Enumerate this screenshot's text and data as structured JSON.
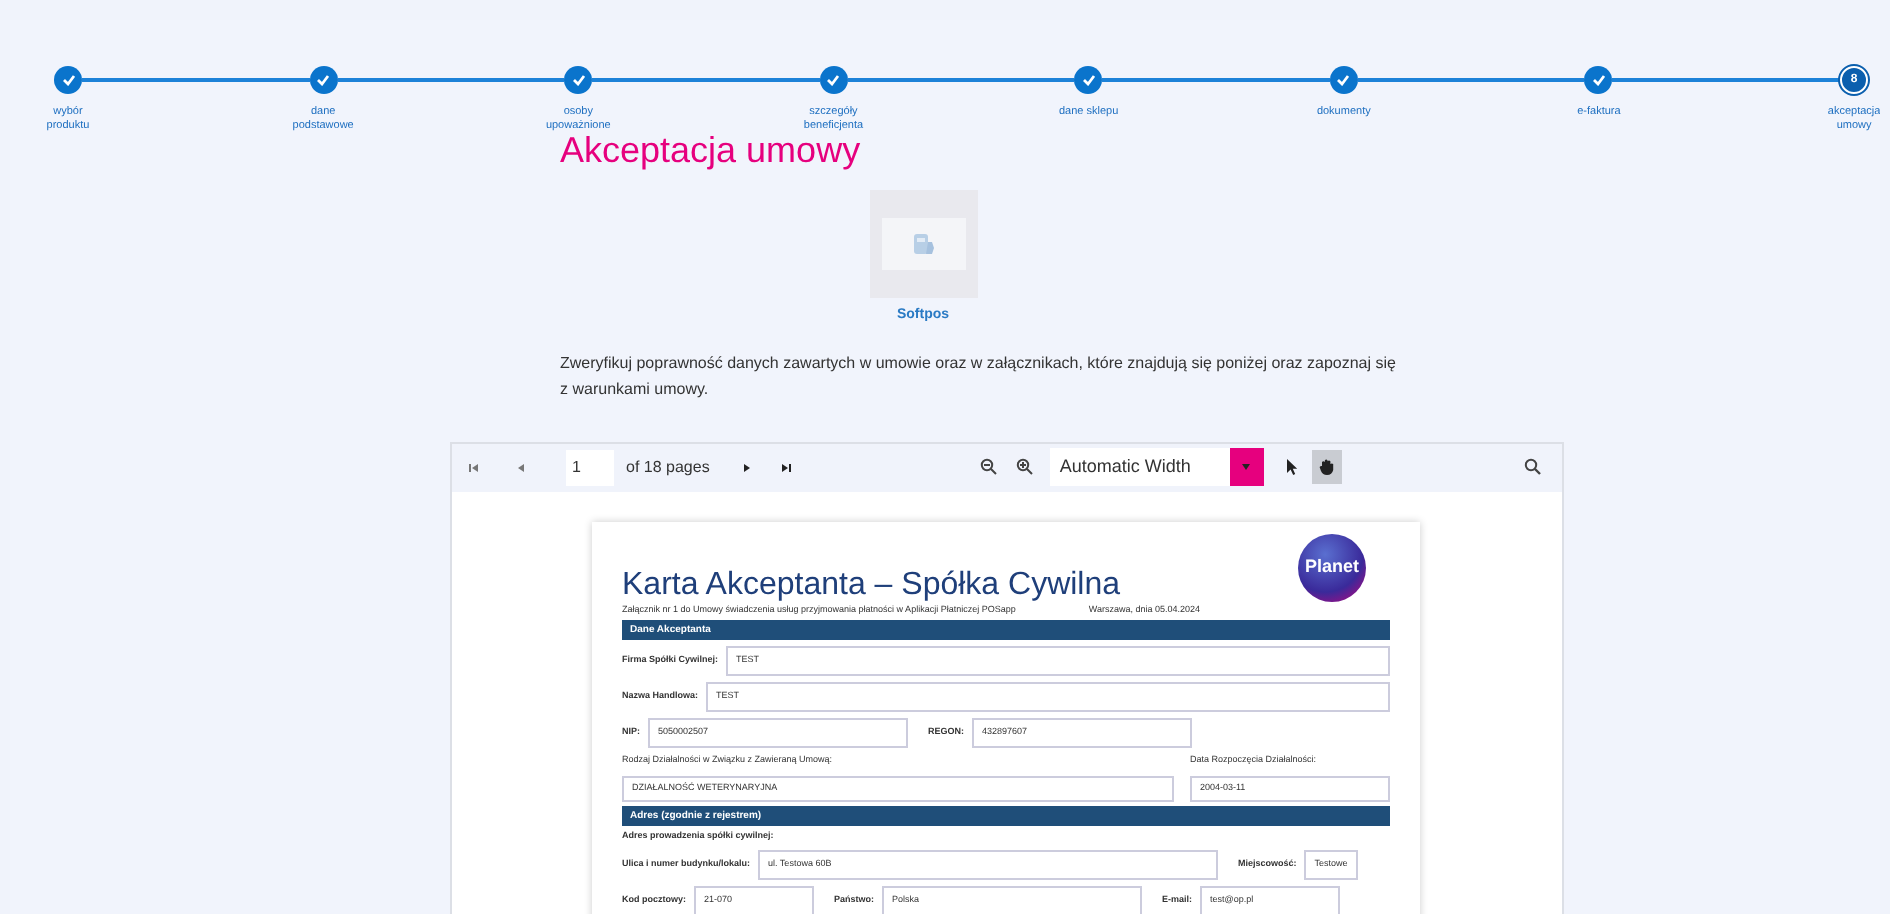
{
  "steps": [
    {
      "label": "wybór produktu",
      "completed": true,
      "current": false
    },
    {
      "label": "dane podstawowe",
      "completed": true,
      "current": false
    },
    {
      "label": "osoby upoważnione",
      "completed": true,
      "current": false
    },
    {
      "label": "szczegóły beneficjenta",
      "completed": true,
      "current": false
    },
    {
      "label": "dane sklepu",
      "completed": true,
      "current": false
    },
    {
      "label": "dokumenty",
      "completed": true,
      "current": false
    },
    {
      "label": "e-faktura",
      "completed": true,
      "current": false
    },
    {
      "label": "akceptacja umowy",
      "completed": false,
      "current": true,
      "number": "8"
    }
  ],
  "title": "Akceptacja umowy",
  "product": {
    "name": "Softpos"
  },
  "instruction": "Zweryfikuj poprawność danych zawartych w umowie oraz w załącznikach, które znajdują się poniżej oraz zapoznaj się z warunkami umowy.",
  "viewer": {
    "page": "1",
    "page_count": "of 18 pages",
    "zoom": "Automatic Width",
    "tools": [
      {
        "kind": "select",
        "selected": false
      },
      {
        "kind": "hand",
        "selected": true
      }
    ],
    "document": {
      "title": "Karta Akceptanta – Spółka Cywilna",
      "subtitle": "Załącznik nr 1 do Umowy świadczenia usług przyjmowania płatności w Aplikacji Płatniczej POSapp",
      "date": "Warszawa, dnia 05.04.2024",
      "logo": "Planet",
      "blocks": [
        {
          "kind": "bar",
          "text": "Dane Akceptanta"
        },
        {
          "kind": "row",
          "cells": [
            {
              "label": "Firma Spółki Cywilnej:",
              "value": "TEST"
            }
          ]
        },
        {
          "kind": "row",
          "cells": [
            {
              "label": "Nazwa Handlowa:",
              "value": "TEST"
            }
          ]
        },
        {
          "kind": "row",
          "cells": [
            {
              "label": "NIP:",
              "value": "5050002507"
            },
            {
              "label": "REGON:",
              "value": "432897607"
            }
          ]
        },
        {
          "kind": "stacked",
          "cells": [
            {
              "label": "Rodzaj Działalności w Związku z Zawieraną Umową:",
              "value": "DZIAŁALNOŚĆ WETERYNARYJNA"
            },
            {
              "label": "Data Rozpoczęcia Działalności:",
              "value": "2004-03-11"
            }
          ]
        },
        {
          "kind": "bar",
          "text": "Adres **(zgodnie z rejestrem)**"
        },
        {
          "kind": "note",
          "text": "Adres prowadzenia spółki cywilnej:"
        },
        {
          "kind": "row",
          "cells": [
            {
              "label": "Ulica i numer budynku/lokalu:",
              "value": "ul. Testowa 60B"
            },
            {
              "label": "Miejscowość:",
              "value": "Testowe"
            }
          ]
        },
        {
          "kind": "row",
          "cells": [
            {
              "label": "Kod pocztowy:",
              "value": "21-070"
            },
            {
              "label": "Państwo:",
              "value": "Polska"
            },
            {
              "label": "E-mail:",
              "value": "test@op.pl"
            }
          ]
        }
      ]
    }
  }
}
